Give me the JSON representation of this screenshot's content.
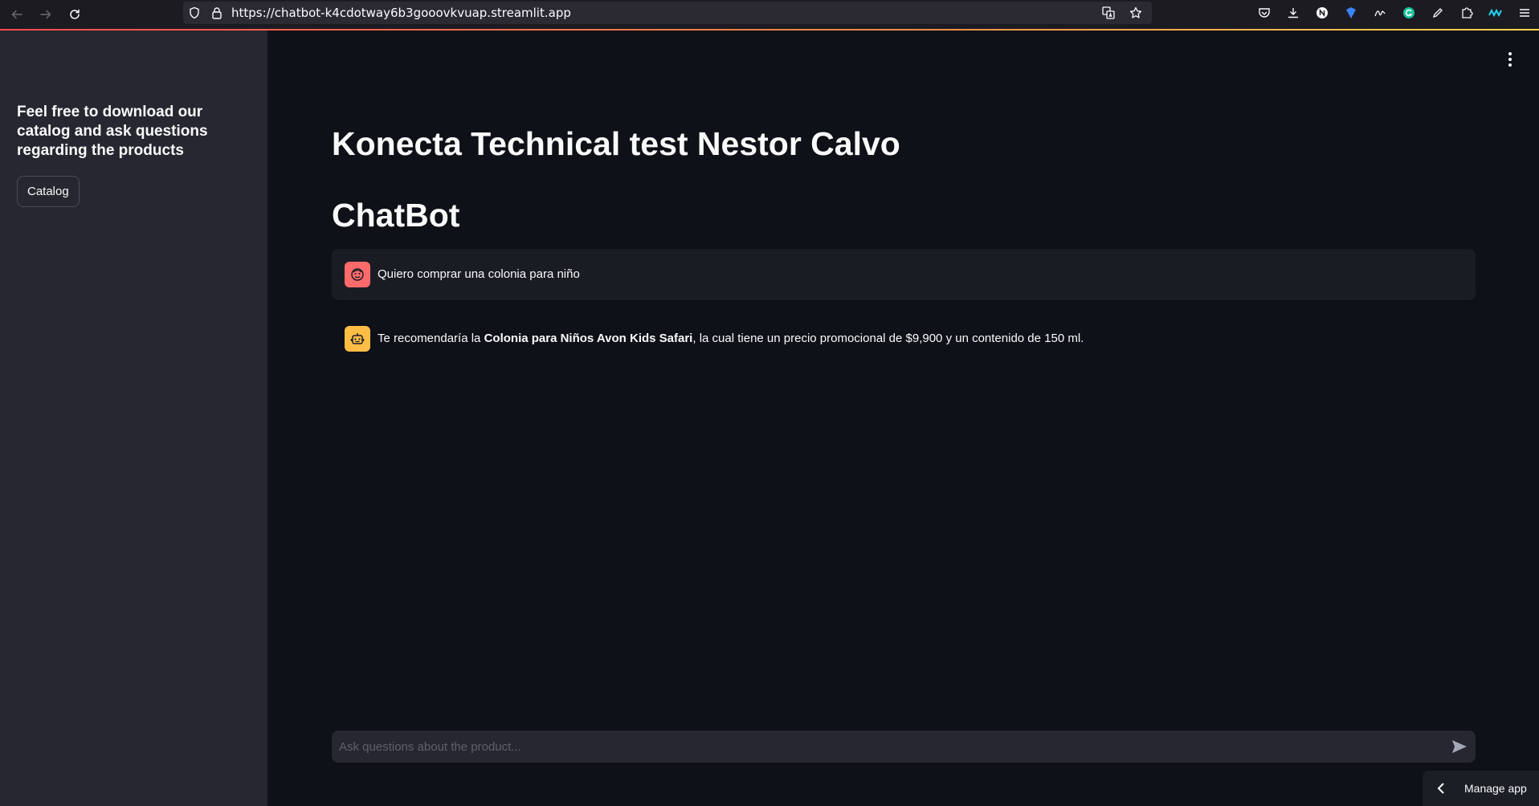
{
  "browser": {
    "url": "https://chatbot-k4cdotway6b3gooovkvuap.streamlit.app"
  },
  "sidebar": {
    "intro_text": "Feel free to download our catalog and ask questions regarding the products",
    "catalog_button": "Catalog"
  },
  "main": {
    "title": "Konecta Technical test Nestor Calvo",
    "subtitle": "ChatBot",
    "messages": [
      {
        "role": "user",
        "text": "Quiero comprar una colonia para niño"
      },
      {
        "role": "assistant",
        "text_before": "Te recomendaría la ",
        "text_bold": "Colonia para Niños Avon Kids Safari",
        "text_after": ", la cual tiene un precio promocional de $9,900 y un contenido de 150 ml."
      }
    ],
    "chat_input_placeholder": "Ask questions about the product..."
  },
  "footer": {
    "manage_app_label": "Manage app"
  },
  "colors": {
    "background": "#0e1117",
    "sidebar": "#262730",
    "user_avatar": "#ff6b6b",
    "bot_avatar": "#ffbd45"
  }
}
